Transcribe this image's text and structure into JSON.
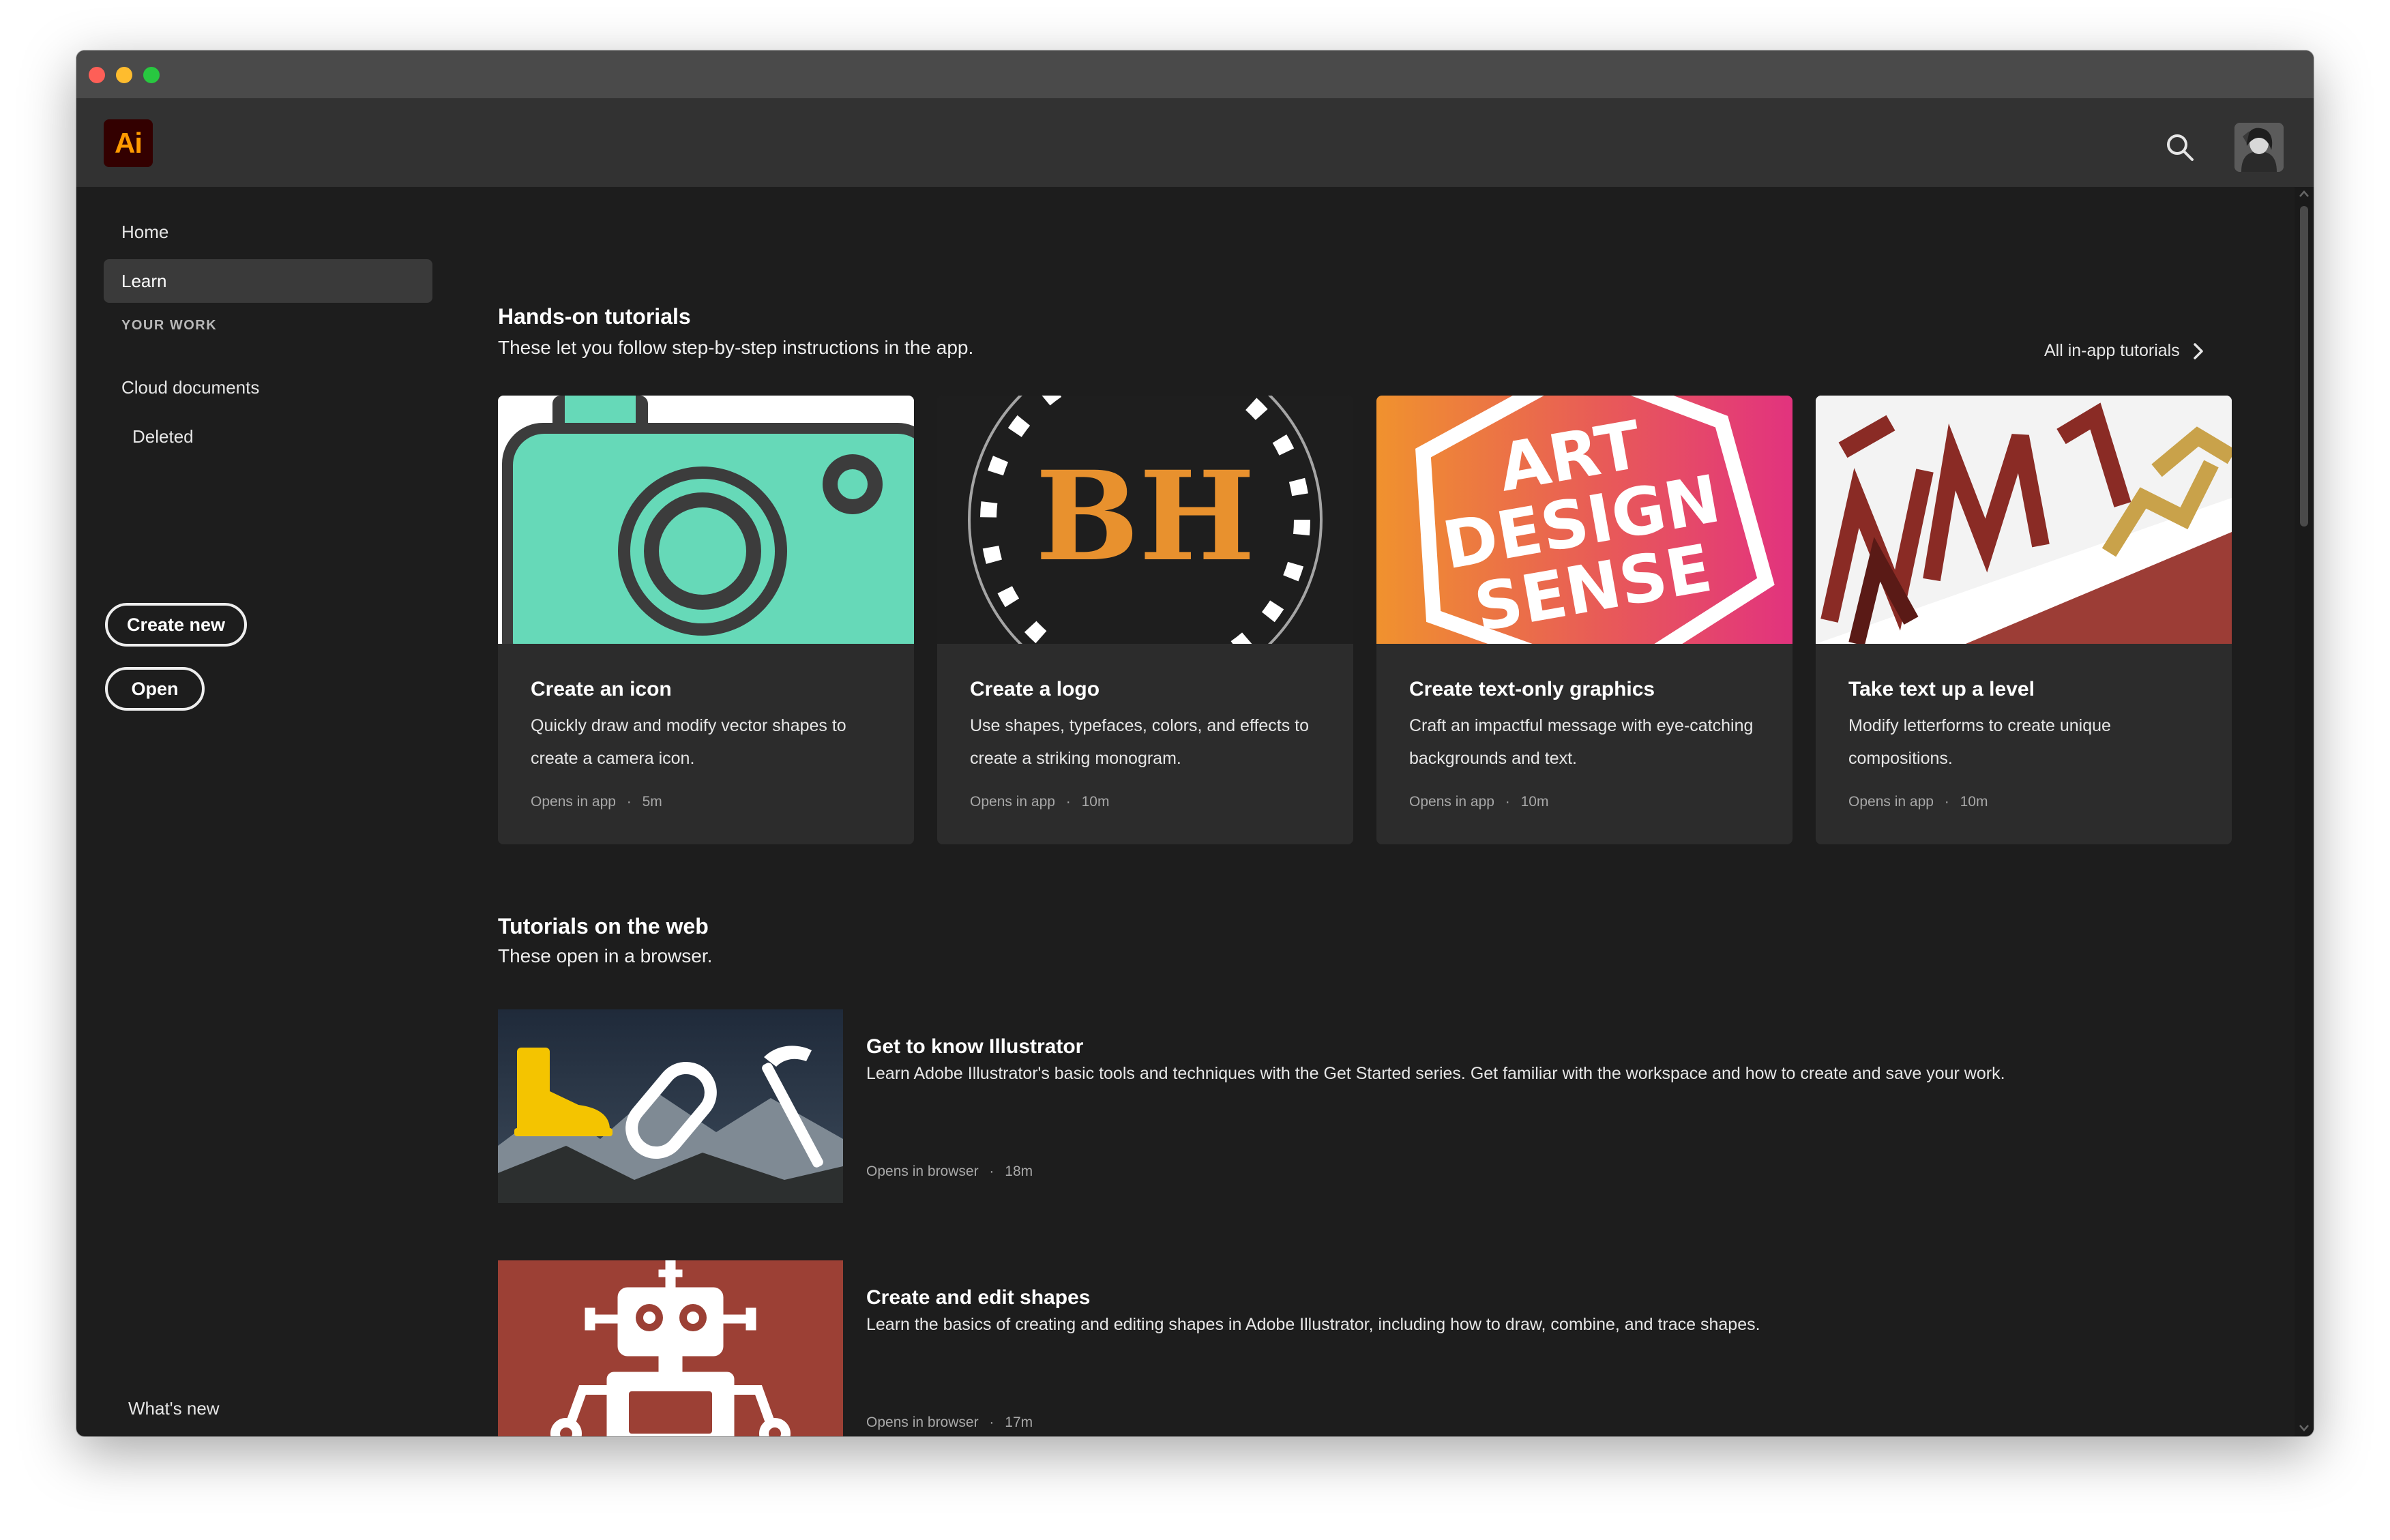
{
  "app": {
    "logo_text": "Ai"
  },
  "sidebar": {
    "home_label": "Home",
    "learn_label": "Learn",
    "section_label": "YOUR WORK",
    "cloud_label": "Cloud documents",
    "deleted_label": "Deleted",
    "create_new_label": "Create new",
    "open_label": "Open",
    "whats_new_label": "What's new"
  },
  "hands_on": {
    "title": "Hands-on tutorials",
    "subtitle": "These let you follow step-by-step instructions in the app.",
    "all_link": "All in-app tutorials",
    "cards": [
      {
        "title": "Create an icon",
        "desc": "Quickly draw and modify vector shapes to create a camera icon.",
        "opens": "Opens in app",
        "duration": "5m"
      },
      {
        "title": "Create a logo",
        "desc": "Use shapes, typefaces, colors, and effects to create a striking monogram.",
        "opens": "Opens in app",
        "duration": "10m",
        "art_text": "BH"
      },
      {
        "title": "Create text-only graphics",
        "desc": "Craft an impactful message with eye-catching backgrounds and text.",
        "opens": "Opens in app",
        "duration": "10m",
        "art_lines": [
          "ART",
          "DESIGN",
          "SENSE"
        ]
      },
      {
        "title": "Take text up a level",
        "desc": "Modify letterforms to create unique compositions.",
        "opens": "Opens in app",
        "duration": "10m"
      }
    ]
  },
  "web": {
    "title": "Tutorials on the web",
    "subtitle": "These open in a browser.",
    "items": [
      {
        "title": "Get to know Illustrator",
        "desc": "Learn Adobe Illustrator's basic tools and techniques with the Get Started series. Get familiar with the workspace and how to create and save your work.",
        "opens": "Opens in browser",
        "duration": "18m"
      },
      {
        "title": "Create and edit shapes",
        "desc": "Learn the basics of creating and editing shapes in Adobe Illustrator, including how to draw, combine, and trace shapes.",
        "opens": "Opens in browser",
        "duration": "17m"
      }
    ]
  },
  "meta_separator": "·",
  "colors": {
    "window_bg": "#1d1d1d",
    "card_bg": "#2c2c2c",
    "accent_logo": "#ff9a00",
    "camera_teal": "#66d9b8",
    "robot_red": "#9c4035"
  },
  "icons": [
    "search-icon",
    "chevron-right-icon",
    "avatar"
  ]
}
